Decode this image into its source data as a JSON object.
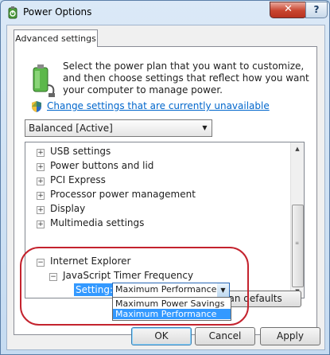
{
  "window": {
    "title": "Power Options"
  },
  "titlebar": {
    "help_glyph": "?",
    "close_glyph": "✕"
  },
  "tabs": [
    {
      "label": "Advanced settings"
    }
  ],
  "intro_text": "Select the power plan that you want to customize, and then choose settings that reflect how you want your computer to manage power.",
  "change_settings_link": "Change settings that are currently unavailable",
  "plan_select": {
    "value": "Balanced [Active]"
  },
  "tree": {
    "items": [
      {
        "label": "USB settings",
        "expander": "+"
      },
      {
        "label": "Power buttons and lid",
        "expander": "+"
      },
      {
        "label": "PCI Express",
        "expander": "+"
      },
      {
        "label": "Processor power management",
        "expander": "+"
      },
      {
        "label": "Display",
        "expander": "+"
      },
      {
        "label": "Multimedia settings",
        "expander": "+"
      },
      {
        "label": "Internet Explorer",
        "expander": "−"
      },
      {
        "label": "JavaScript Timer Frequency",
        "expander": "−"
      }
    ],
    "setting_label": "Setting:",
    "setting_value": "Maximum Performance",
    "options": [
      "Maximum Power Savings",
      "Maximum Performance"
    ]
  },
  "restore_button": "Restore plan defaults",
  "buttons": {
    "ok": "OK",
    "cancel": "Cancel",
    "apply": "Apply"
  },
  "colors": {
    "accent": "#3399ff",
    "link": "#0066cc",
    "annotation": "#c4232e"
  },
  "icons": [
    "power-options-icon",
    "battery-plug-icon",
    "uac-shield-icon",
    "expand-icon",
    "collapse-icon",
    "dropdown-arrow-icon"
  ]
}
